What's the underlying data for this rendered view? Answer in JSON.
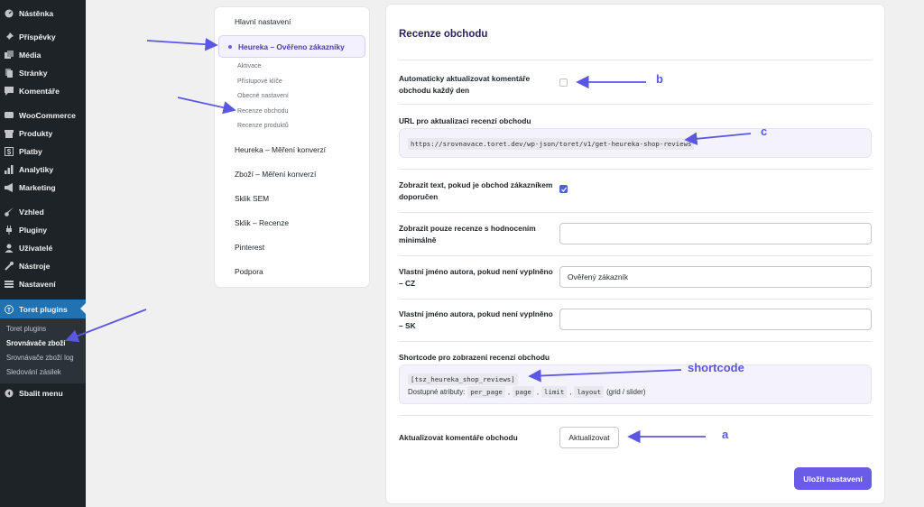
{
  "wp_menu": [
    {
      "label": "Nástěnka",
      "icon": "dashboard-icon"
    },
    {
      "label": "Příspěvky",
      "icon": "pin-icon"
    },
    {
      "label": "Média",
      "icon": "media-icon"
    },
    {
      "label": "Stránky",
      "icon": "page-icon"
    },
    {
      "label": "Komentáře",
      "icon": "comment-icon"
    },
    {
      "label": "WooCommerce",
      "icon": "woo-icon"
    },
    {
      "label": "Produkty",
      "icon": "archive-icon"
    },
    {
      "label": "Platby",
      "icon": "dollar-icon"
    },
    {
      "label": "Analytiky",
      "icon": "chart-icon"
    },
    {
      "label": "Marketing",
      "icon": "megaphone-icon"
    },
    {
      "label": "Vzhled",
      "icon": "brush-icon"
    },
    {
      "label": "Pluginy",
      "icon": "plug-icon"
    },
    {
      "label": "Uživatelé",
      "icon": "user-icon"
    },
    {
      "label": "Nástroje",
      "icon": "wrench-icon"
    },
    {
      "label": "Nastavení",
      "icon": "settings-icon"
    },
    {
      "label": "Toret plugins",
      "icon": "toret-icon"
    },
    {
      "label": "Sbalit menu",
      "icon": "collapse-icon"
    }
  ],
  "wp_submenu": [
    "Toret plugins",
    "Srovnávače zboží",
    "Srovnávače zboží log",
    "Sledování zásilek"
  ],
  "nav": {
    "main": "Hlavní nastavení",
    "active": "Heureka – Ověřeno zákazníky",
    "sub": [
      "Aktivace",
      "Přístupové klíče",
      "Obecné nastavení",
      "Recenze obchodu",
      "Recenze produktů"
    ],
    "items": [
      "Heureka – Měření konverzí",
      "Zboží – Měření konverzí",
      "Sklik SEM",
      "Sklik – Recenze",
      "Pinterest",
      "Podpora"
    ]
  },
  "card": {
    "title": "Recenze obchodu",
    "auto_update_label": "Automaticky aktualizovat komentáře obchodu každý den",
    "url_label": "URL pro aktualizaci recenzí obchodu",
    "url_value": "https://srovnavace.toret.dev/wp-json/toret/v1/get-heureka-shop-reviews",
    "show_text_label": "Zobrazit text, pokud je obchod zákazníkem doporučen",
    "min_rating_label": "Zobrazit pouze recenze s hodnocením minimálně",
    "min_rating_value": "",
    "author_cz_label": "Vlastní jméno autora, pokud není vyplněno – CZ",
    "author_cz_value": "Ověřený zákazník",
    "author_sk_label": "Vlastní jméno autora, pokud není vyplněno – SK",
    "author_sk_value": "",
    "shortcode_label": "Shortcode pro zobrazení recenzí obchodu",
    "shortcode": "[tsz_heureka_shop_reviews]",
    "attrs_prefix": "Dostupné atributy:",
    "attrs": [
      "per_page",
      "page",
      "limit",
      "layout"
    ],
    "attrs_suffix": "(grid / slider)",
    "update_label": "Aktualizovat komentáře obchodu",
    "update_button": "Aktualizovat",
    "save_button": "Uložit nastavení",
    "auto_update_checked": false,
    "show_text_checked": true
  },
  "annotations": {
    "a": "a",
    "b": "b",
    "c": "c",
    "shortcode": "shortcode"
  },
  "colors": {
    "accent": "#6b5ce8",
    "annotation": "#5b57e4",
    "wp_active": "#2271b1"
  }
}
